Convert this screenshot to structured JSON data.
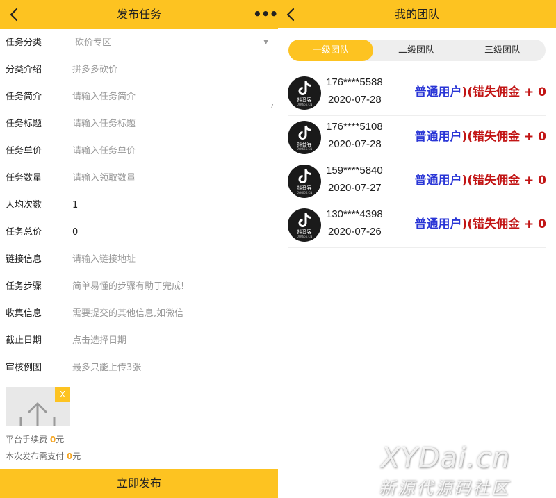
{
  "publish": {
    "title": "发布任务",
    "more": "•••",
    "rows": [
      {
        "label": "任务分类",
        "value": "砍价专区"
      },
      {
        "label": "分类介绍",
        "value": "拼多多砍价"
      },
      {
        "label": "任务简介",
        "value": "请输入任务简介"
      },
      {
        "label": "任务标题",
        "value": "请输入任务标题"
      },
      {
        "label": "任务单价",
        "value": "请输入任务单价"
      },
      {
        "label": "任务数量",
        "value": "请输入领取数量"
      },
      {
        "label": "人均次数",
        "value": "1"
      },
      {
        "label": "任务总价",
        "value": "0"
      },
      {
        "label": "链接信息",
        "value": "请输入链接地址"
      },
      {
        "label": "任务步骤",
        "value": "简单易懂的步骤有助于完成!"
      },
      {
        "label": "收集信息",
        "value": "需要提交的其他信息,如微信"
      },
      {
        "label": "截止日期",
        "value": "点击选择日期"
      },
      {
        "label": "审核例图",
        "value": "最多只能上传3张"
      }
    ],
    "upload_close": "X",
    "fee_label": "平台手续费",
    "fee_value": "0",
    "fee_unit": "元",
    "pay_label": "本次发布需支付",
    "pay_value": "0",
    "pay_unit": "元",
    "submit_label": "立即发布"
  },
  "team": {
    "title": "我的团队",
    "tabs": [
      "一级团队",
      "二级团队",
      "三级团队"
    ],
    "active_tab": "一级团队",
    "avatar_brand": "抖音客",
    "avatar_site": "DYK666.CN",
    "members": [
      {
        "phone": "176****5588",
        "date": "2020-07-28",
        "role": "普通用户",
        "earn": ")(错失佣金 + 0"
      },
      {
        "phone": "176****5108",
        "date": "2020-07-28",
        "role": "普通用户",
        "earn": ")(错失佣金 + 0"
      },
      {
        "phone": "159****5840",
        "date": "2020-07-27",
        "role": "普通用户",
        "earn": ")(错失佣金 + 0"
      },
      {
        "phone": "130****4398",
        "date": "2020-07-26",
        "role": "普通用户",
        "earn": ")(错失佣金 + 0"
      }
    ]
  },
  "watermark": {
    "line1": "XYDai.cn",
    "line2": "新源代源码社区"
  },
  "colors": {
    "accent": "#fdc321",
    "role": "#2a36d6",
    "earn": "#c21515",
    "fee": "#f5a623"
  },
  "icons": [
    "back-arrow-icon",
    "more-icon",
    "dropdown-arrow-icon",
    "upload-icon",
    "tiktok-logo-icon"
  ]
}
